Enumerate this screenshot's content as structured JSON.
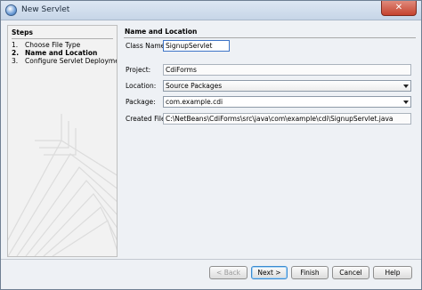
{
  "window": {
    "title": "New Servlet",
    "close_glyph": "✕"
  },
  "steps": {
    "heading": "Steps",
    "items": [
      {
        "num": "1.",
        "label": "Choose File Type"
      },
      {
        "num": "2.",
        "label": "Name and Location"
      },
      {
        "num": "3.",
        "label": "Configure Servlet Deployment"
      }
    ],
    "active_index": 1
  },
  "panel": {
    "heading": "Name and Location",
    "class_name": {
      "label": "Class Name:",
      "value": "SignupServlet"
    },
    "project": {
      "label": "Project:",
      "value": "CdiForms"
    },
    "location": {
      "label": "Location:",
      "value": "Source Packages"
    },
    "package": {
      "label": "Package:",
      "value": "com.example.cdi"
    },
    "created_file": {
      "label": "Created File:",
      "value": "C:\\NetBeans\\CdiForms\\src\\java\\com\\example\\cdi\\SignupServlet.java"
    }
  },
  "buttons": {
    "back": "< Back",
    "next": "Next >",
    "finish": "Finish",
    "cancel": "Cancel",
    "help": "Help"
  },
  "colors": {
    "accent": "#3a8ad0",
    "title_bar": "#c6d5e7",
    "close": "#c5432f"
  }
}
